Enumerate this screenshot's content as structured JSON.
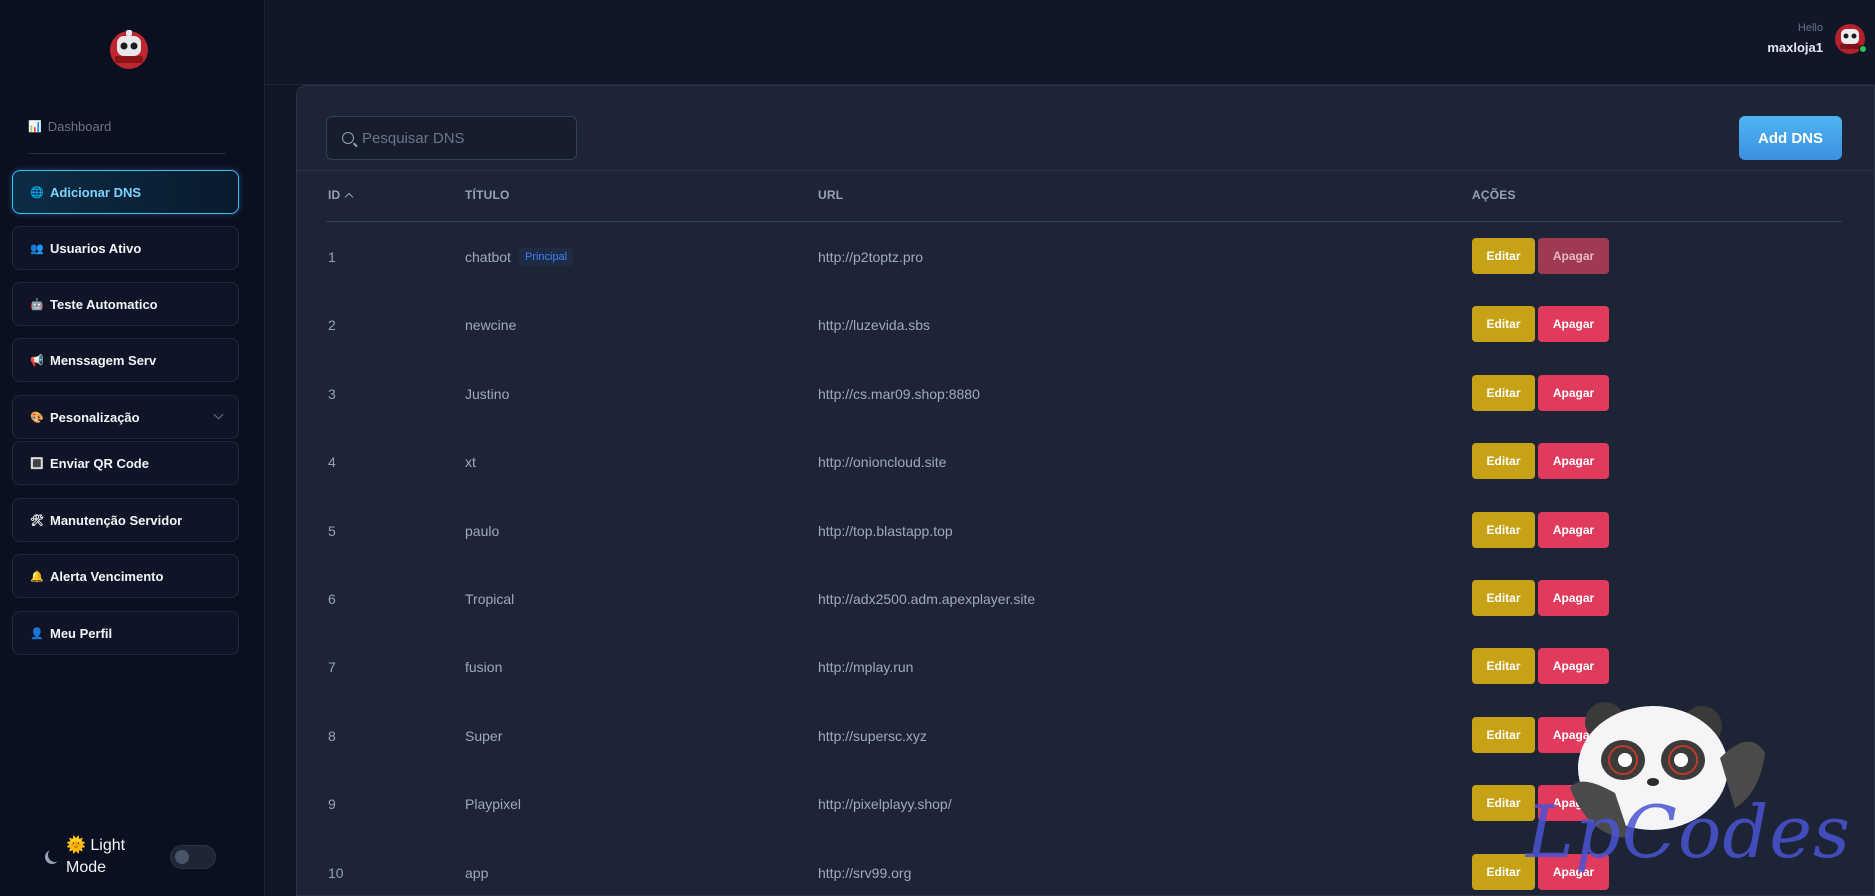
{
  "sidebar": {
    "dashboard": {
      "icon": "bar-chart-icon",
      "label": "Dashboard"
    },
    "items": [
      {
        "icon": "globe-icon",
        "glyph": "🌐",
        "label": "Adicionar DNS",
        "active": true
      },
      {
        "icon": "users-icon",
        "glyph": "👥",
        "label": "Usuarios Ativo"
      },
      {
        "icon": "robot-icon",
        "glyph": "🤖",
        "label": "Teste Automatico"
      },
      {
        "icon": "megaphone-icon",
        "glyph": "📢",
        "label": "Menssagem Serv"
      },
      {
        "icon": "palette-icon",
        "glyph": "🎨",
        "label": "Pesonalização",
        "has_dropdown": true
      },
      {
        "icon": "qr-code-icon",
        "glyph": "🔳",
        "label": "Enviar QR Code"
      },
      {
        "icon": "tools-icon",
        "glyph": "🛠",
        "label": "Manutenção Servidor"
      },
      {
        "icon": "bell-icon",
        "glyph": "🔔",
        "label": "Alerta Vencimento"
      },
      {
        "icon": "user-icon",
        "glyph": "👤",
        "label": "Meu Perfil"
      }
    ],
    "mode": {
      "icon": "sun-icon",
      "label_line1": "🌞 Light",
      "label_line2": "Mode",
      "enabled": false
    }
  },
  "header": {
    "greeting": "Hello",
    "username": "maxloja1"
  },
  "toolbar": {
    "search_placeholder": "Pesquisar DNS",
    "search_value": "",
    "add_label": "Add DNS"
  },
  "table": {
    "columns": [
      "ID",
      "TÍTULO",
      "URL",
      "AÇÕES"
    ],
    "sort": {
      "column": "ID",
      "direction": "asc"
    },
    "edit_label": "Editar",
    "delete_label": "Apagar",
    "rows": [
      {
        "id": "1",
        "title": "chatbot",
        "badge": "Principal",
        "url": "http://p2toptz.pro",
        "delete_disabled": true
      },
      {
        "id": "2",
        "title": "newcine",
        "url": "http://luzevida.sbs"
      },
      {
        "id": "3",
        "title": "Justino",
        "url": "http://cs.mar09.shop:8880"
      },
      {
        "id": "4",
        "title": "xt",
        "url": "http://onioncloud.site"
      },
      {
        "id": "5",
        "title": "paulo",
        "url": "http://top.blastapp.top"
      },
      {
        "id": "6",
        "title": "Tropical",
        "url": "http://adx2500.adm.apexplayer.site"
      },
      {
        "id": "7",
        "title": "fusion",
        "url": "http://mplay.run"
      },
      {
        "id": "8",
        "title": "Super",
        "url": "http://supersc.xyz"
      },
      {
        "id": "9",
        "title": "Playpixel",
        "url": "http://pixelplayy.shop/"
      },
      {
        "id": "10",
        "title": "app",
        "url": "http://srv99.org"
      }
    ]
  },
  "watermark": {
    "text": "LpCodes",
    "icon": "panda-mascot-icon"
  },
  "colors": {
    "accent": "#38bdf8",
    "edit": "#c7a116",
    "delete": "#e03a5d",
    "bg": "#0d1220"
  }
}
